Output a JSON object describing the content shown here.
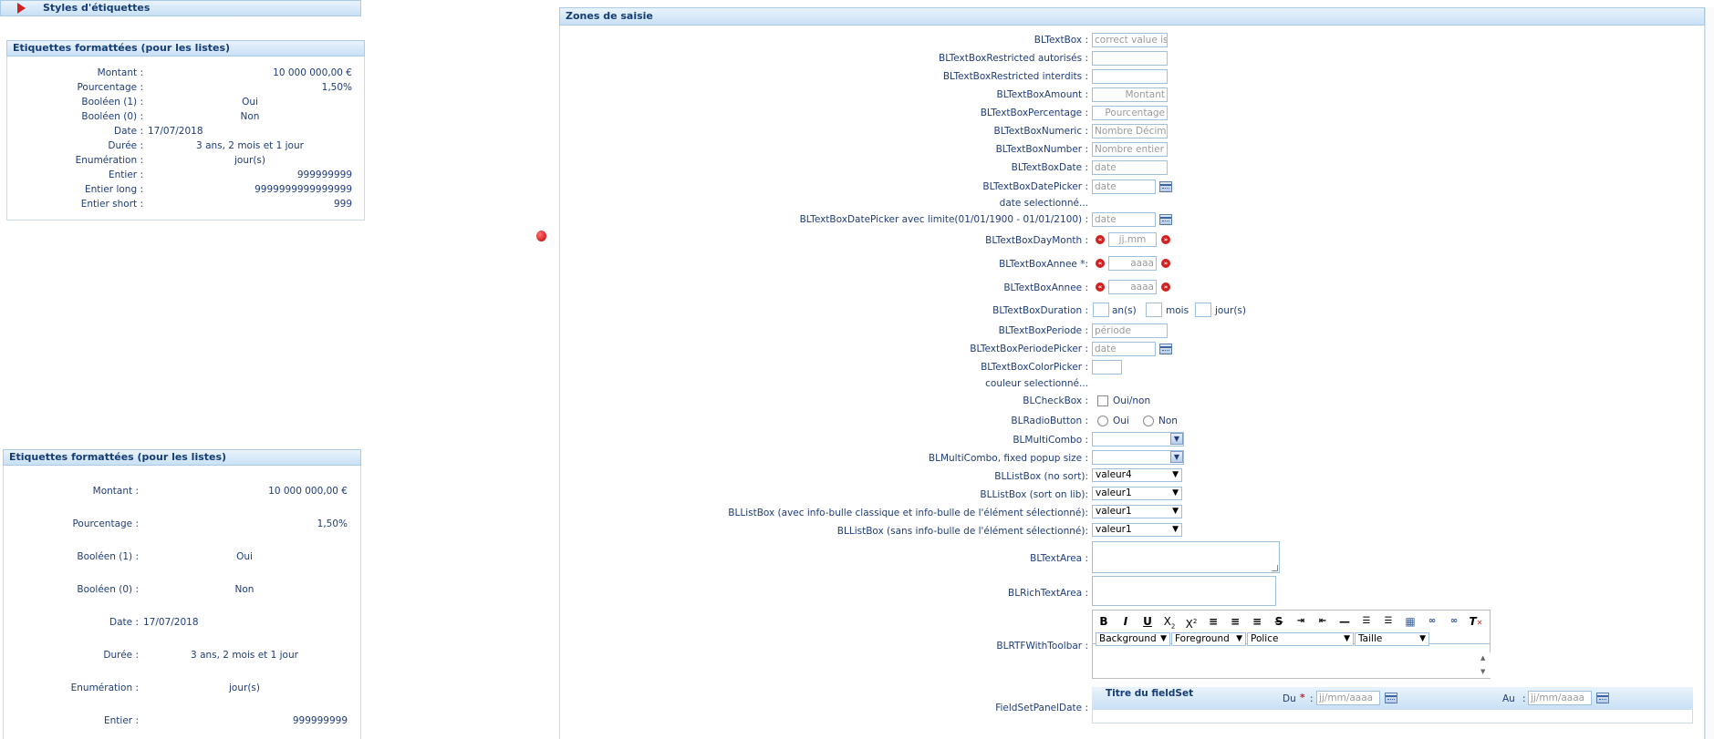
{
  "styles_header": "Styles d'étiquettes",
  "list1": {
    "title": "Etiquettes formattées (pour les listes)",
    "rows": [
      {
        "label": "Montant :",
        "value": "10 000 000,00 €"
      },
      {
        "label": "Pourcentage :",
        "value": "1,50%"
      },
      {
        "label": "Booléen (1) :",
        "value": "Oui"
      },
      {
        "label": "Booléen (0) :",
        "value": "Non"
      },
      {
        "label": "Date :",
        "value": "17/07/2018"
      },
      {
        "label": "Durée :",
        "value": "3 ans, 2 mois et 1 jour"
      },
      {
        "label": "Enumération :",
        "value": "jour(s)"
      },
      {
        "label": "Entier :",
        "value": "999999999"
      },
      {
        "label": "Entier long :",
        "value": "9999999999999999"
      },
      {
        "label": "Entier short :",
        "value": "999"
      }
    ]
  },
  "list2": {
    "title": "Etiquettes formattées (pour les listes)",
    "rows": [
      {
        "label": "Montant :",
        "value": "10 000 000,00 €"
      },
      {
        "label": "Pourcentage :",
        "value": "1,50%"
      },
      {
        "label": "Booléen (1) :",
        "value": "Oui"
      },
      {
        "label": "Booléen (0) :",
        "value": "Non"
      },
      {
        "label": "Date :",
        "value": "17/07/2018"
      },
      {
        "label": "Durée :",
        "value": "3 ans, 2 mois et 1 jour"
      },
      {
        "label": "Enumération :",
        "value": "jour(s)"
      },
      {
        "label": "Entier :",
        "value": "999999999"
      }
    ]
  },
  "zones": {
    "title": "Zones de saisie",
    "textbox": {
      "label": "BLTextBox :",
      "value": "correct value is"
    },
    "restricted_ok": {
      "label": "BLTextBoxRestricted autorisés :"
    },
    "restricted_ko": {
      "label": "BLTextBoxRestricted interdits :"
    },
    "amount": {
      "label": "BLTextBoxAmount :",
      "placeholder": "Montant"
    },
    "percentage": {
      "label": "BLTextBoxPercentage :",
      "placeholder": "Pourcentage"
    },
    "numeric": {
      "label": "BLTextBoxNumeric :",
      "placeholder": "Nombre Décimal"
    },
    "number": {
      "label": "BLTextBoxNumber :",
      "placeholder": "Nombre entier"
    },
    "date": {
      "label": "BLTextBoxDate :",
      "placeholder": "date"
    },
    "datepicker": {
      "label": "BLTextBoxDatePicker :",
      "placeholder": "date",
      "sub": "date selectionné..."
    },
    "datepicker_lim": {
      "label": "BLTextBoxDatePicker avec limite(01/01/1900 - 01/01/2100) :",
      "placeholder": "date"
    },
    "daymonth": {
      "label": "BLTextBoxDayMonth :",
      "placeholder": "jj.mm"
    },
    "annee_req": {
      "label": "BLTextBoxAnnee *:",
      "placeholder": "aaaa"
    },
    "annee": {
      "label": "BLTextBoxAnnee :",
      "placeholder": "aaaa"
    },
    "duration": {
      "label": "BLTextBoxDuration :",
      "years": "an(s)",
      "months": "mois",
      "days": "jour(s)"
    },
    "periode": {
      "label": "BLTextBoxPeriode :",
      "placeholder": "période"
    },
    "periodepicker": {
      "label": "BLTextBoxPeriodePicker :",
      "placeholder": "date"
    },
    "colorpicker": {
      "label": "BLTextBoxColorPicker :",
      "sub": "couleur selectionné..."
    },
    "checkbox": {
      "label": "BLCheckBox :",
      "text": "Oui/non"
    },
    "radio": {
      "label": "BLRadioButton :",
      "opt1": "Oui",
      "opt2": "Non"
    },
    "multicombo": {
      "label": "BLMultiCombo :"
    },
    "multicombo_fixed": {
      "label": "BLMultiCombo, fixed popup size :"
    },
    "listbox_nosort": {
      "label": "BLListBox (no sort):",
      "value": "valeur4"
    },
    "listbox_sortlib": {
      "label": "BLListBox (sort on lib):",
      "value": "valeur1"
    },
    "listbox_info": {
      "label": "BLListBox (avec info-bulle classique et info-bulle de l'élément sélectionné):",
      "value": "valeur1"
    },
    "listbox_noinfo": {
      "label": "BLListBox (sans info-bulle de l'élément sélectionné):",
      "value": "valeur1"
    },
    "textarea": {
      "label": "BLTextArea :"
    },
    "richtextarea": {
      "label": "BLRichTextArea :"
    },
    "rtf": {
      "label": "BLRTFWithToolbar :",
      "background": "Background",
      "foreground": "Foreground",
      "police": "Police",
      "taille": "Taille"
    },
    "fieldset": {
      "label": "FieldSetPanelDate :",
      "title": "Titre du fieldSet",
      "du": "Du",
      "au": "Au",
      "required": "*",
      "colon": ":",
      "placeholder": "jj/mm/aaaa"
    }
  }
}
